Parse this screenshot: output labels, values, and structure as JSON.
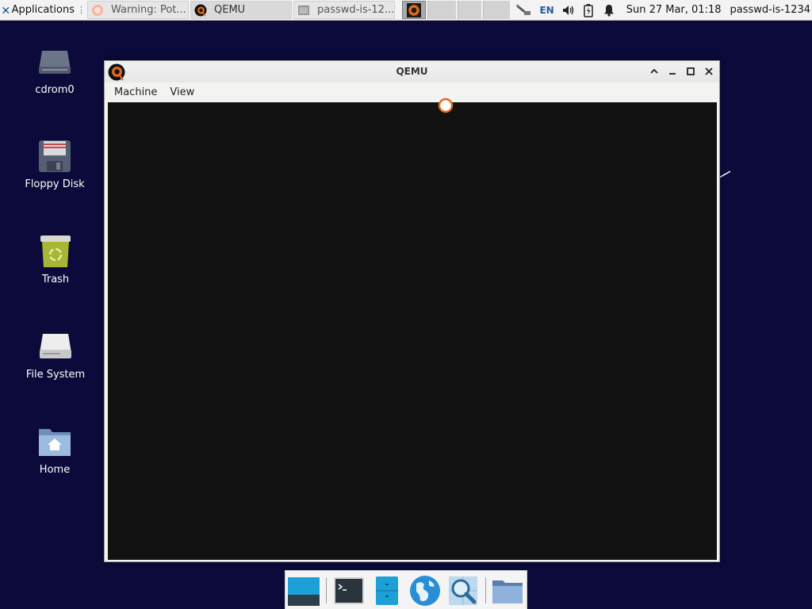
{
  "top_panel": {
    "applications_label": "Applications",
    "grip": "⋮",
    "tasks": [
      {
        "label": "Warning: Pot...",
        "icon": "firefox-icon"
      },
      {
        "label": "QEMU",
        "icon": "qemu-icon"
      },
      {
        "label": "passwd-is-12...",
        "icon": "terminal-icon"
      }
    ],
    "tray": {
      "language": "EN",
      "clock": "Sun 27 Mar, 01:18",
      "hostname": "passwd-is-1234"
    }
  },
  "desktop_icons": [
    {
      "label": "cdrom0",
      "icon": "cdrom-drive-icon"
    },
    {
      "label": "Floppy Disk",
      "icon": "floppy-disk-icon"
    },
    {
      "label": "Trash",
      "icon": "trash-icon"
    },
    {
      "label": "File System",
      "icon": "file-system-drive-icon"
    },
    {
      "label": "Home",
      "icon": "home-folder-icon"
    }
  ],
  "qemu_window": {
    "title": "QEMU",
    "menu": {
      "machine": "Machine",
      "view": "View"
    }
  },
  "dock": {
    "items": [
      "show-desktop-icon",
      "terminal-icon",
      "file-manager-icon",
      "web-browser-icon",
      "app-finder-icon",
      "folder-icon"
    ]
  },
  "colors": {
    "desktop_background": "#0b0a3a",
    "panel": "#f3f3f3",
    "vm_screen": "#121212"
  }
}
